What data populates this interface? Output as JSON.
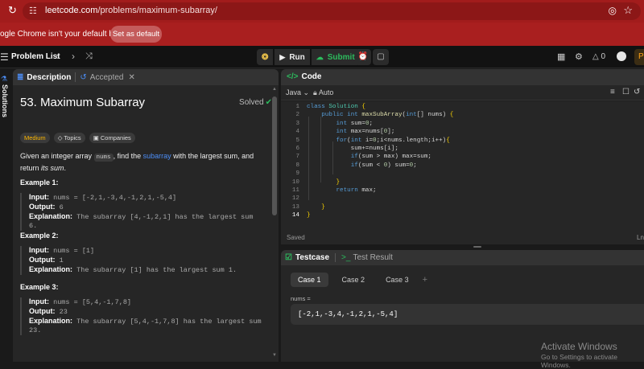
{
  "browser": {
    "url_domain": "leetcode.com",
    "url_path": "/problems/maximum-subarray/",
    "infobar_message": "ogle Chrome isn't your default browser",
    "infobar_button": "Set as default"
  },
  "topnav": {
    "problem_list": "Problem List",
    "run": "Run",
    "submit": "Submit",
    "streak_count": "0"
  },
  "sidebar": {
    "solutions_label": "Solutions"
  },
  "left": {
    "tab_description": "Description",
    "tab_accepted": "Accepted",
    "title": "53. Maximum Subarray",
    "solved": "Solved",
    "tags": [
      "Medium",
      "Topics",
      "Companies"
    ],
    "desc_pre": "Given an integer array ",
    "desc_code": "nums",
    "desc_mid": ", find the ",
    "desc_link": "subarray",
    "desc_post": " with the largest sum, and return ",
    "desc_em": "its sum",
    "desc_end": ".",
    "examples": [
      {
        "title": "Example 1:",
        "input": "nums = [-2,1,-3,4,-1,2,1,-5,4]",
        "output": "6",
        "explanation": "The subarray [4,-1,2,1] has the largest sum 6."
      },
      {
        "title": "Example 2:",
        "input": "nums = [1]",
        "output": "1",
        "explanation": "The subarray [1] has the largest sum 1."
      },
      {
        "title": "Example 3:",
        "input": "nums = [5,4,-1,7,8]",
        "output": "23",
        "explanation_line1": "The subarray [5,4,-1,7,8] has the largest sum",
        "explanation_line2": "23."
      }
    ],
    "labels": {
      "input": "Input:",
      "output": "Output:",
      "explanation": "Explanation:"
    }
  },
  "code": {
    "header": "Code",
    "language": "Java",
    "autosave": "Auto",
    "status": "Saved",
    "cursor": "Ln",
    "lines": [
      "class Solution {",
      "    public int maxSubArray(int[] nums) {",
      "        int sum=0;",
      "        int max=nums[0];",
      "        for(int i=0;i<nums.length;i++){",
      "            sum+=nums[i];",
      "            if(sum > max) max=sum;",
      "            if(sum < 0) sum=0;",
      "",
      "        }",
      "        return max;",
      "",
      "    }",
      "}"
    ]
  },
  "testcase": {
    "tab_testcase": "Testcase",
    "tab_result": "Test Result",
    "cases": [
      "Case 1",
      "Case 2",
      "Case 3"
    ],
    "param_label": "nums =",
    "param_value": "[-2,1,-3,4,-1,2,1,-5,4]"
  },
  "watermark": {
    "title": "Activate Windows",
    "sub": "Go to Settings to activate Windows."
  }
}
